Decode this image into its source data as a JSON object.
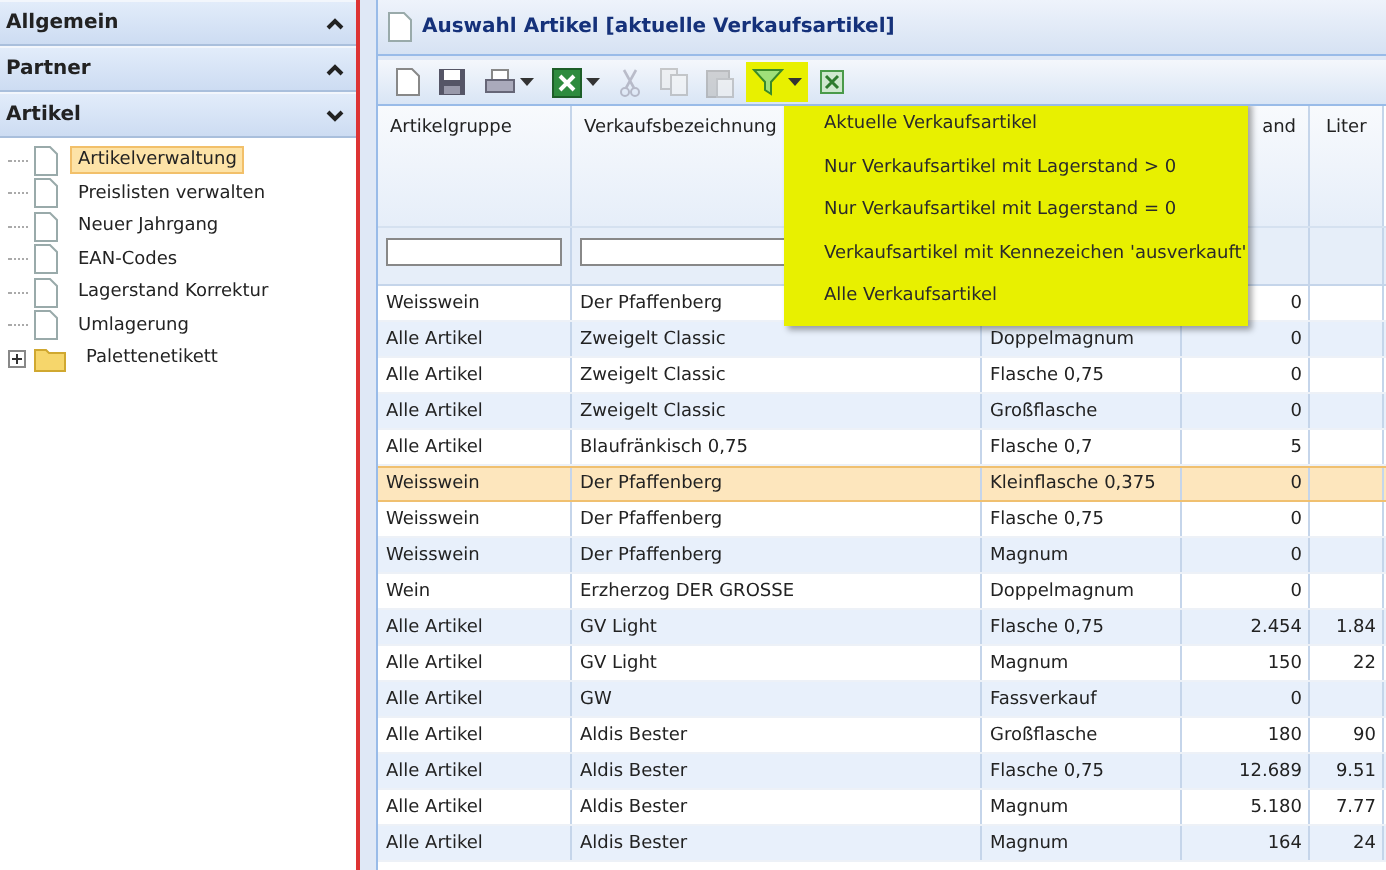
{
  "sidebar": {
    "sections": [
      {
        "title": "Allgemein",
        "expanded": false
      },
      {
        "title": "Partner",
        "expanded": false
      },
      {
        "title": "Artikel",
        "expanded": true,
        "items": [
          {
            "label": "Artikelverwaltung",
            "kind": "page",
            "selected": true
          },
          {
            "label": "Preislisten verwalten",
            "kind": "page",
            "selected": false
          },
          {
            "label": "Neuer Jahrgang",
            "kind": "page",
            "selected": false
          },
          {
            "label": "EAN-Codes",
            "kind": "page",
            "selected": false
          },
          {
            "label": "Lagerstand Korrektur",
            "kind": "page",
            "selected": false
          },
          {
            "label": "Umlagerung",
            "kind": "page",
            "selected": false
          },
          {
            "label": "Palettenetikett",
            "kind": "folder",
            "selected": false,
            "expanded": false
          }
        ]
      }
    ]
  },
  "panel": {
    "title": "Auswahl Artikel [aktuelle Verkaufsartikel]"
  },
  "toolbar": [
    {
      "kind": "new",
      "dropdown": false,
      "disabled": false,
      "active": false
    },
    {
      "kind": "save",
      "dropdown": false,
      "disabled": false,
      "active": false
    },
    {
      "kind": "print",
      "dropdown": true,
      "disabled": false,
      "active": false
    },
    {
      "kind": "excel",
      "dropdown": true,
      "disabled": false,
      "active": false
    },
    {
      "kind": "cut",
      "dropdown": false,
      "disabled": true,
      "active": false
    },
    {
      "kind": "copy",
      "dropdown": false,
      "disabled": true,
      "active": false
    },
    {
      "kind": "paste",
      "dropdown": false,
      "disabled": true,
      "active": false
    },
    {
      "kind": "filter",
      "dropdown": true,
      "disabled": false,
      "active": true
    },
    {
      "kind": "export",
      "dropdown": false,
      "disabled": false,
      "active": false
    }
  ],
  "filter_menu": {
    "items": [
      "Aktuelle Verkaufsartikel",
      "Nur Verkaufsartikel mit Lagerstand > 0",
      "Nur Verkaufsartikel mit Lagerstand = 0",
      "Verkaufsartikel mit Kennezeichen 'ausverkauft'",
      "Alle Verkaufsartikel"
    ]
  },
  "table": {
    "columns": [
      {
        "label": "Artikelgruppe",
        "filter": true
      },
      {
        "label": "Verkaufsbezeichnung",
        "filter": true
      },
      {},
      {
        "label": "and",
        "filter": false
      },
      {
        "label": "Liter",
        "filter": false
      }
    ],
    "rows": [
      {
        "selected": false,
        "cells": [
          "Weisswein",
          "Der Pfaffenberg",
          null,
          "0",
          null
        ]
      },
      {
        "selected": false,
        "cells": [
          "Alle Artikel",
          "Zweigelt Classic",
          "Doppelmagnum",
          "0",
          null
        ]
      },
      {
        "selected": false,
        "cells": [
          "Alle Artikel",
          "Zweigelt Classic",
          "Flasche 0,75",
          "0",
          null
        ]
      },
      {
        "selected": false,
        "cells": [
          "Alle Artikel",
          "Zweigelt Classic",
          "Großflasche",
          "0",
          null
        ]
      },
      {
        "selected": false,
        "cells": [
          "Alle Artikel",
          "Blaufränkisch 0,75",
          "Flasche 0,7",
          "5",
          null
        ]
      },
      {
        "selected": true,
        "cells": [
          "Weisswein",
          "Der Pfaffenberg",
          "Kleinflasche 0,375",
          "0",
          null
        ]
      },
      {
        "selected": false,
        "cells": [
          "Weisswein",
          "Der Pfaffenberg",
          "Flasche 0,75",
          "0",
          null
        ]
      },
      {
        "selected": false,
        "cells": [
          "Weisswein",
          "Der Pfaffenberg",
          "Magnum",
          "0",
          null
        ]
      },
      {
        "selected": false,
        "cells": [
          "Wein",
          "Erzherzog DER GROSSE",
          "Doppelmagnum",
          "0",
          null
        ]
      },
      {
        "selected": false,
        "cells": [
          "Alle Artikel",
          "GV Light",
          "Flasche 0,75",
          "2.454",
          "1.84"
        ]
      },
      {
        "selected": false,
        "cells": [
          "Alle Artikel",
          "GV Light",
          "Magnum",
          "150",
          "22"
        ]
      },
      {
        "selected": false,
        "cells": [
          "Alle Artikel",
          "GW",
          "Fassverkauf",
          "0",
          null
        ]
      },
      {
        "selected": false,
        "cells": [
          "Alle Artikel",
          "Aldis Bester",
          "Großflasche",
          "180",
          "90"
        ]
      },
      {
        "selected": false,
        "cells": [
          "Alle Artikel",
          "Aldis Bester",
          "Flasche 0,75",
          "12.689",
          "9.51"
        ]
      },
      {
        "selected": false,
        "cells": [
          "Alle Artikel",
          "Aldis Bester",
          "Magnum",
          "5.180",
          "7.77"
        ]
      },
      {
        "selected": false,
        "cells": [
          "Alle Artikel",
          "Aldis Bester",
          "Magnum",
          "164",
          "24"
        ]
      }
    ]
  }
}
